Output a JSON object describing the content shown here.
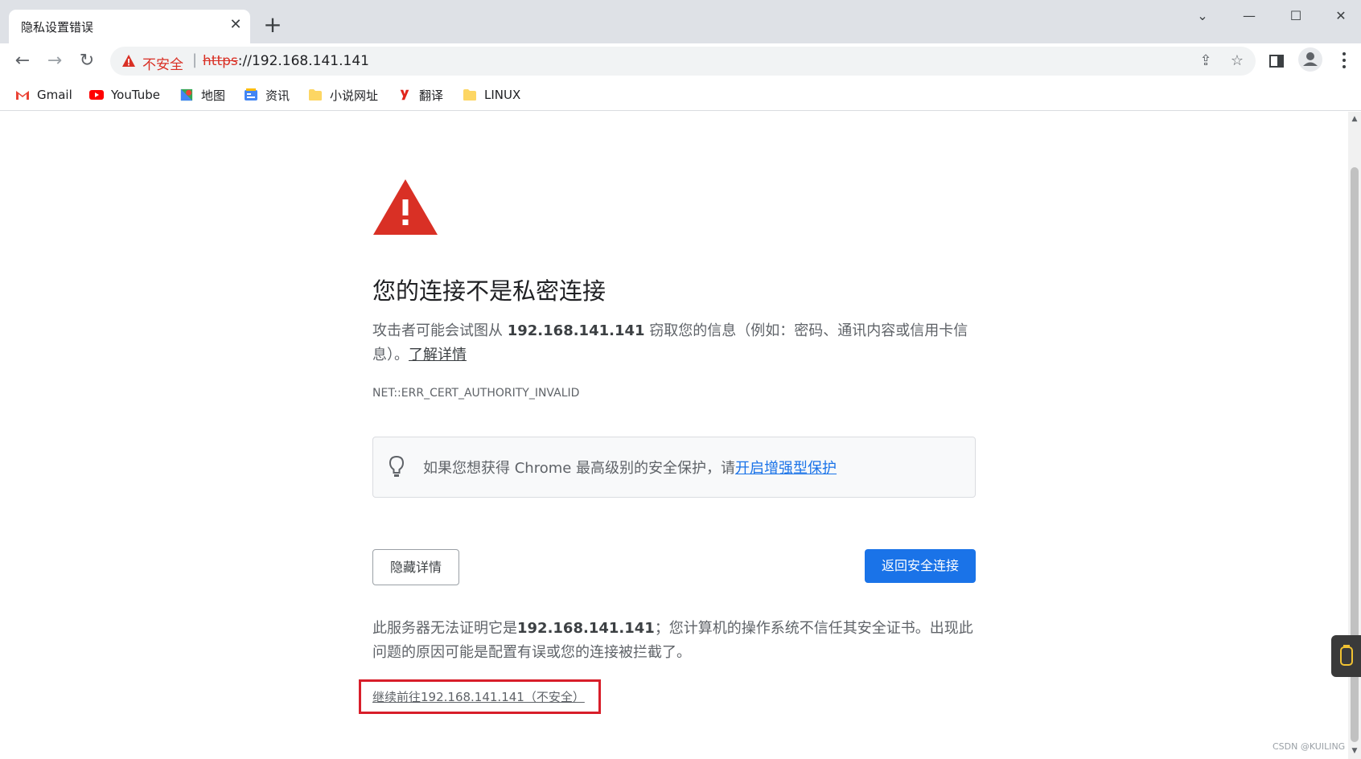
{
  "tab": {
    "title": "隐私设置错误",
    "close_label": "✕",
    "new_tab_label": "+"
  },
  "window_controls": {
    "dropdown": "⌄",
    "minimize": "—",
    "maximize": "☐",
    "close": "✕"
  },
  "toolbar": {
    "back": "←",
    "forward": "→",
    "reload": "↻"
  },
  "omnibox": {
    "security_label": "不安全",
    "separator": "|",
    "url_scheme": "https",
    "url_rest": "://192.168.141.141",
    "share_icon": "⇪",
    "star_icon": "☆"
  },
  "bookmarks": [
    {
      "label": "Gmail",
      "icon": "gmail-icon",
      "color": "#ea4335"
    },
    {
      "label": "YouTube",
      "icon": "youtube-icon",
      "color": "#ff0000"
    },
    {
      "label": "地图",
      "icon": "maps-icon",
      "color": "#34a853"
    },
    {
      "label": "资讯",
      "icon": "news-icon",
      "color": "#4285f4"
    },
    {
      "label": "小说网址",
      "icon": "folder-icon",
      "color": "#fdd663"
    },
    {
      "label": "翻译",
      "icon": "youdao-icon",
      "color": "#e1251b"
    },
    {
      "label": "LINUX",
      "icon": "folder-icon",
      "color": "#fdd663"
    }
  ],
  "page": {
    "headline": "您的连接不是私密连接",
    "desc_prefix": "攻击者可能会试图从 ",
    "desc_host": "192.168.141.141",
    "desc_suffix": " 窃取您的信息（例如：密码、通讯内容或信用卡信息）。",
    "learn_more": "了解详情",
    "error_code": "NET::ERR_CERT_AUTHORITY_INVALID",
    "promo_text": "如果您想获得 Chrome 最高级别的安全保护，请",
    "promo_link": "开启增强型保护",
    "hide_details_button": "隐藏详情",
    "back_button": "返回安全连接",
    "details_prefix": "此服务器无法证明它是",
    "details_host": "192.168.141.141",
    "details_suffix": "；您计算机的操作系统不信任其安全证书。出现此问题的原因可能是配置有误或您的连接被拦截了。",
    "proceed_link": "继续前往192.168.141.141（不安全）"
  },
  "watermark": "CSDN @KUILING",
  "colors": {
    "accent": "#1a73e8",
    "danger": "#d93025",
    "highlight_box": "#d81e2a"
  }
}
